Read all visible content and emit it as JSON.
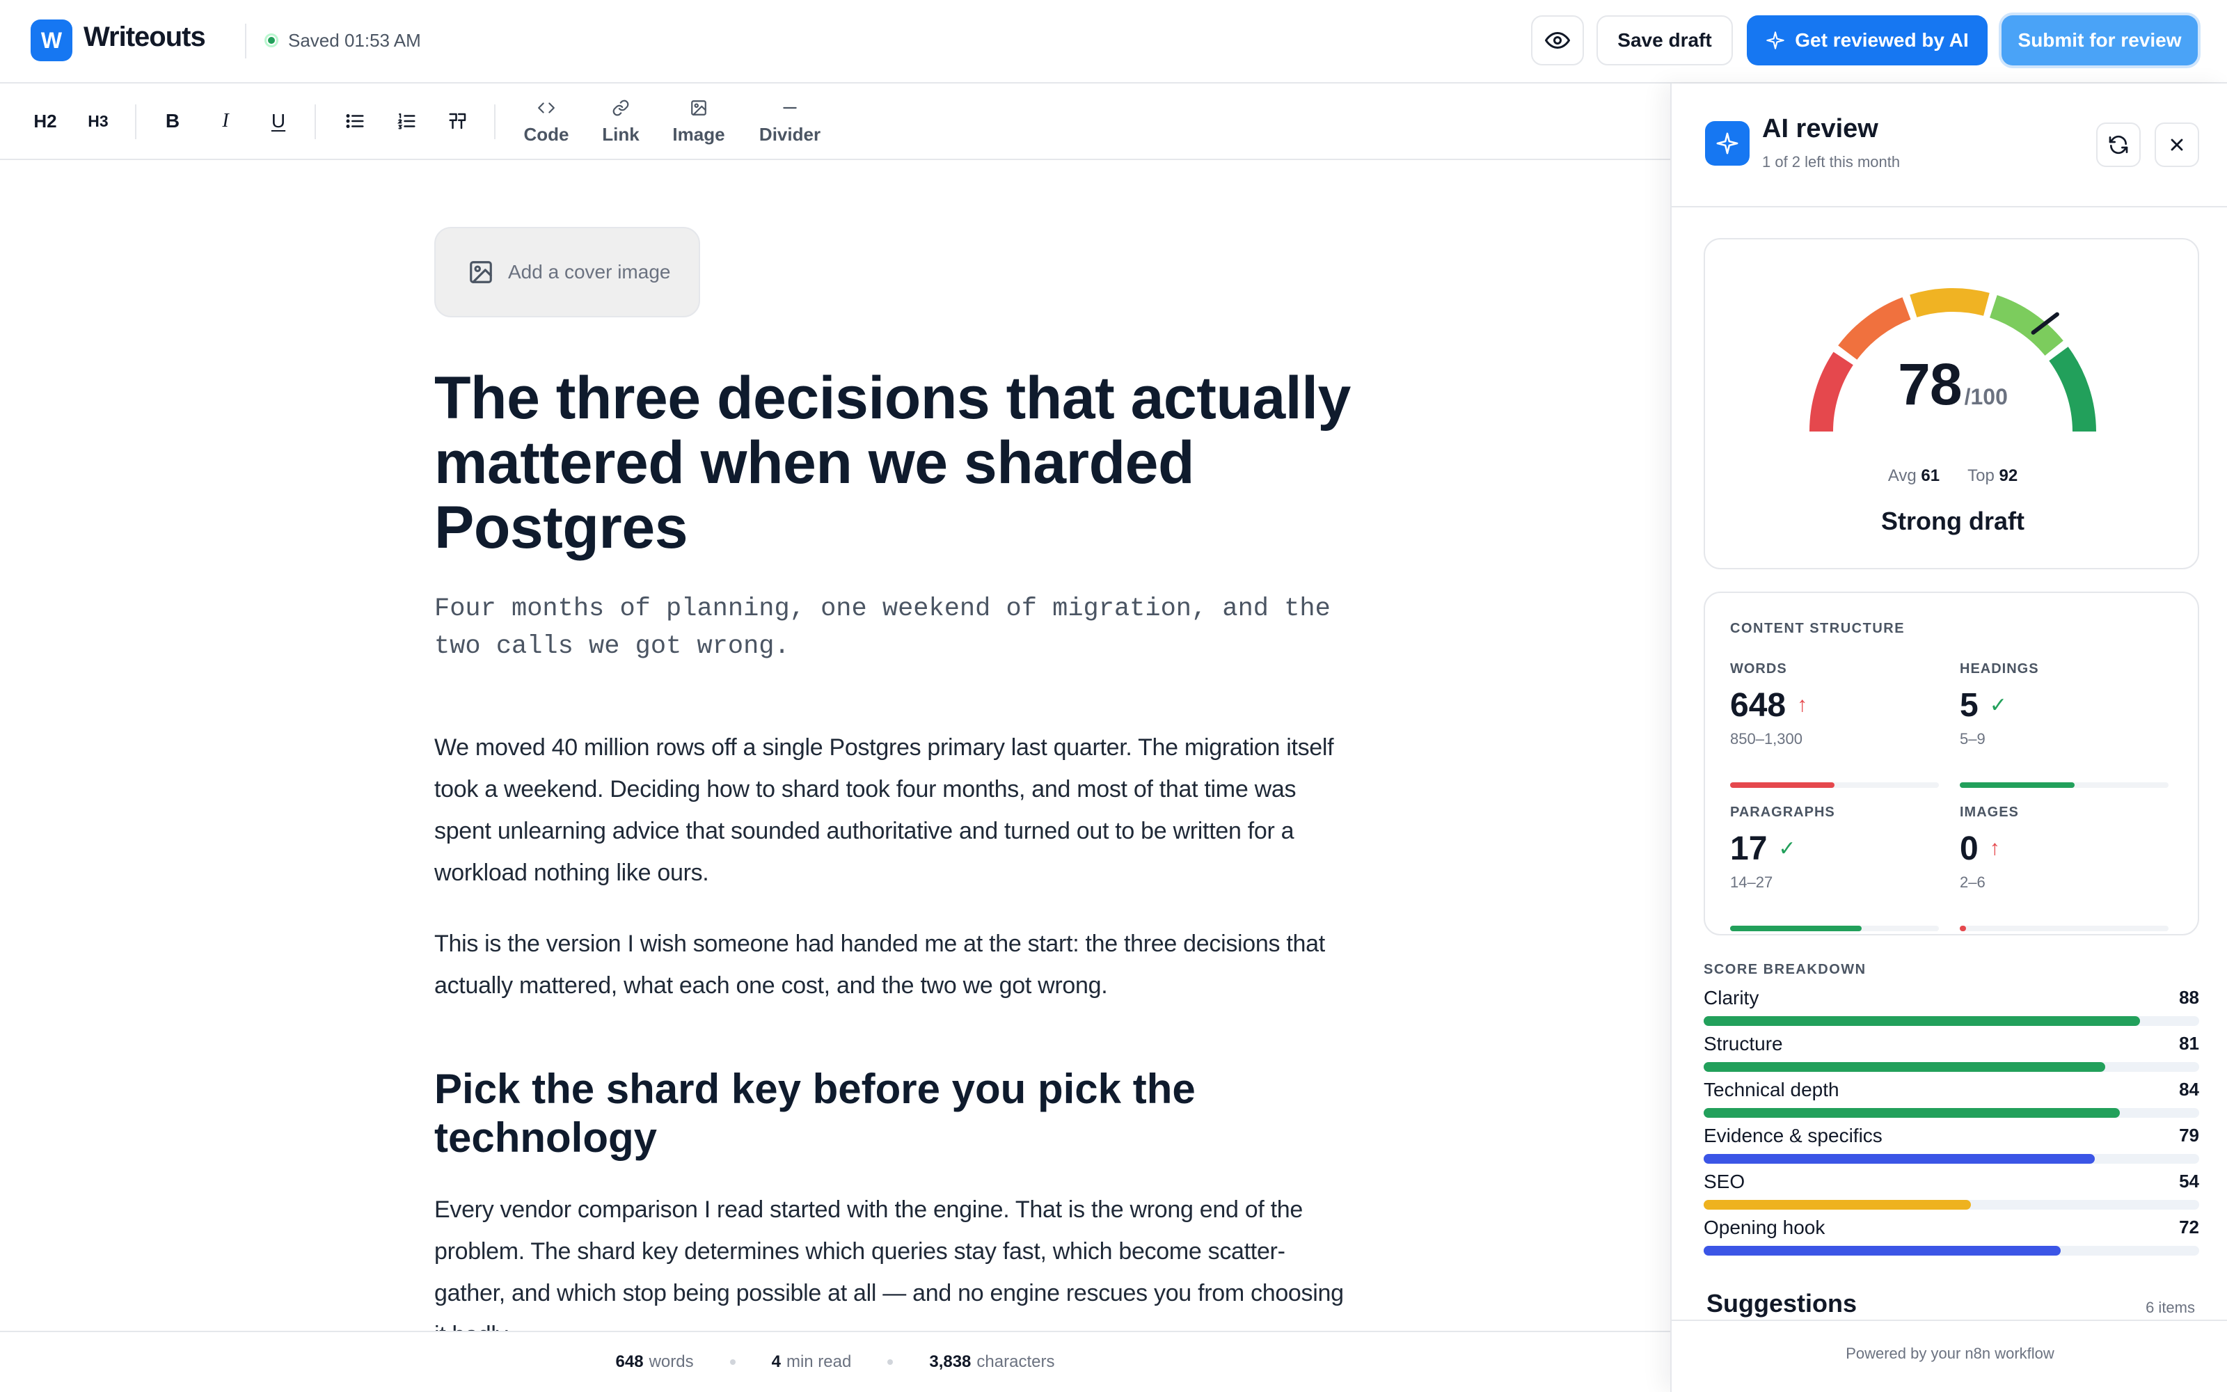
{
  "app": {
    "logo_letter": "W",
    "name": "Writeouts",
    "saved_status": "Saved 01:53 AM"
  },
  "actions": {
    "preview_icon": "eye-icon",
    "save_draft": "Save draft",
    "ai_review": "Get reviewed by AI",
    "submit": "Submit for review"
  },
  "toolbar": {
    "h2": "H2",
    "h3": "H3",
    "bold": "B",
    "italic": "I",
    "underline": "U",
    "code": "Code",
    "link": "Link",
    "image": "Image",
    "divider": "Divider"
  },
  "editor": {
    "cover_image": "Add a cover image",
    "title": "The three decisions that actually mattered when we sharded Postgres",
    "subtitle": "Four months of planning, one weekend of migration, and the two calls we got wrong.",
    "paragraphs": [
      "We moved 40 million rows off a single Postgres primary last quarter. The migration itself took a weekend. Deciding how to shard took four months, and most of that time was spent unlearning advice that sounded authoritative and turned out to be written for a workload nothing like ours.",
      "This is the version I wish someone had handed me at the start: the three decisions that actually mattered, what each one cost, and the two we got wrong."
    ],
    "heading_1": "Pick the shard key before you pick the technology",
    "paragraph_3": "Every vendor comparison I read started with the engine. That is the wrong end of the problem. The shard key determines which queries stay fast, which become scatter-gather, and which stop being possible at all — and no engine rescues you from choosing it badly."
  },
  "footer": {
    "words": "648",
    "words_label": "words",
    "read": "4",
    "read_label": "min read",
    "chars": "3,838",
    "chars_label": "characters"
  },
  "panel": {
    "title": "AI review",
    "subtitle": "1 of 2 left this month",
    "score": "78",
    "score_max": "/100",
    "score_value": 78,
    "avg_label": "Avg",
    "avg": "61",
    "top_label": "Top",
    "top": "92",
    "verdict": "Strong draft",
    "content_structure": {
      "title": "CONTENT STRUCTURE",
      "metrics": [
        {
          "label": "WORDS",
          "value": "648",
          "status": "up",
          "range": "850–1,300",
          "fill": 0.5,
          "color": "#e5484d"
        },
        {
          "label": "HEADINGS",
          "value": "5",
          "status": "ok",
          "range": "5–9",
          "fill": 0.55,
          "color": "#22a05b"
        },
        {
          "label": "PARAGRAPHS",
          "value": "17",
          "status": "ok",
          "range": "14–27",
          "fill": 0.63,
          "color": "#22a05b"
        },
        {
          "label": "IMAGES",
          "value": "0",
          "status": "up",
          "range": "2–6",
          "fill": 0.03,
          "color": "#e5484d"
        }
      ]
    },
    "score_breakdown": {
      "title": "SCORE BREAKDOWN",
      "rows": [
        {
          "label": "Clarity",
          "value": "88",
          "fill": 0.88,
          "color": "#22a05b"
        },
        {
          "label": "Structure",
          "value": "81",
          "fill": 0.81,
          "color": "#22a05b"
        },
        {
          "label": "Technical depth",
          "value": "84",
          "fill": 0.84,
          "color": "#22a05b"
        },
        {
          "label": "Evidence & specifics",
          "value": "79",
          "fill": 0.79,
          "color": "#3b55e6"
        },
        {
          "label": "SEO",
          "value": "54",
          "fill": 0.54,
          "color": "#eeb21f"
        },
        {
          "label": "Opening hook",
          "value": "72",
          "fill": 0.72,
          "color": "#3b55e6"
        }
      ]
    },
    "suggestions_title": "Suggestions",
    "suggestions_count": "6 items",
    "powered_by": "Powered by your n8n workflow"
  }
}
